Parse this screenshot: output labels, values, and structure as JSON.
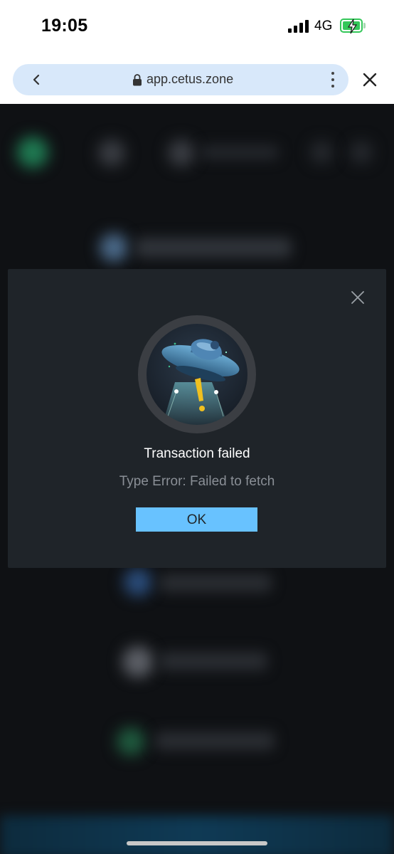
{
  "status_bar": {
    "time": "19:05",
    "network": "4G",
    "battery_color": "#34c759"
  },
  "browser": {
    "url": "app.cetus.zone",
    "icons": [
      "back-chevron-icon",
      "lock-icon",
      "more-vertical-icon",
      "close-icon"
    ],
    "pill_color": "#d8e8fa"
  },
  "modal": {
    "title": "Transaction failed",
    "message": "Type Error: Failed to fetch",
    "ok_label": "OK",
    "icons": [
      "close-icon",
      "ufo-warning-illustration"
    ],
    "accent": "#68c2ff",
    "background": "#1f2429"
  }
}
